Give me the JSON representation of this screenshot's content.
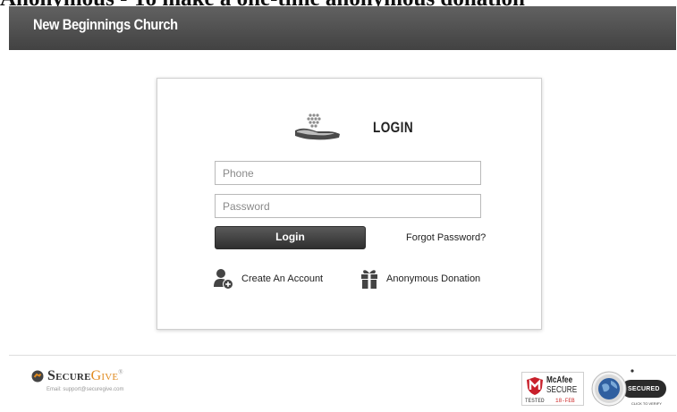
{
  "page_top_text": "Anonymous - To make a one-time anonymous donation",
  "header": {
    "church_name": "New Beginnings Church"
  },
  "login": {
    "title": "LOGIN",
    "phone_placeholder": "Phone",
    "password_placeholder": "Password",
    "login_button": "Login",
    "forgot_password": "Forgot Password?",
    "create_account": "Create An Account",
    "anonymous_donation": "Anonymous Donation"
  },
  "footer": {
    "brand_secure": "Secure",
    "brand_give": "Give",
    "brand_mark": "®",
    "support_email": "Email: support@securegive.com",
    "mcafee": {
      "name": "McAfee",
      "secure": "SECURE",
      "tested": "TESTED",
      "date": "18-FEB"
    },
    "godaddy": {
      "secured": "SECURED",
      "click": "CLICK TO VERIFY"
    }
  },
  "colors": {
    "header_bg": "#4f4f4f",
    "button_bg": "#3c3c3c",
    "give_accent": "#e08a1e",
    "mcafee_red": "#c8202b",
    "godaddy_dark": "#2b2b2b"
  },
  "icons": [
    "hand-giving-icon",
    "add-user-icon",
    "gift-icon",
    "securegive-logo-icon",
    "mcafee-shield-icon",
    "godaddy-globe-icon"
  ]
}
